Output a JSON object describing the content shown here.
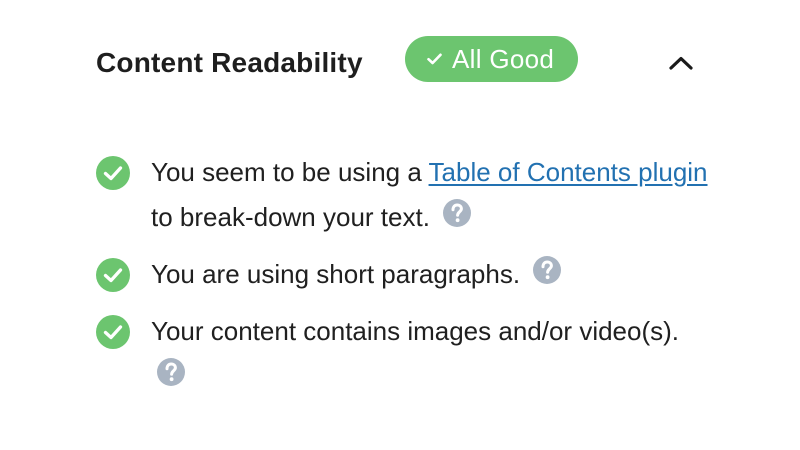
{
  "section": {
    "title": "Content Readability",
    "status_badge": "All Good"
  },
  "checks": [
    {
      "before": "You seem to be using a ",
      "link": "Table of Contents plugin",
      "after": " to break-down your text."
    },
    {
      "text": "You are using short paragraphs."
    },
    {
      "text": "Your content contains images and/or video(s)."
    }
  ],
  "colors": {
    "success": "#6cc56f",
    "link": "#2271b1",
    "help_icon": "#a9b4c2",
    "title_text": "#1e1e1e"
  },
  "icons": {
    "badge": "check-icon",
    "toggle": "chevron-up-icon",
    "item": "check-circle-icon",
    "help": "question-circle-icon"
  }
}
